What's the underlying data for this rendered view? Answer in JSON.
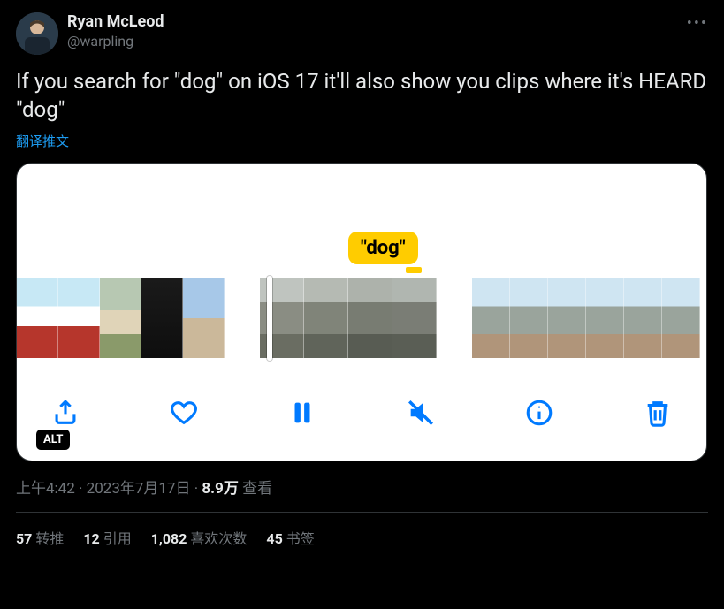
{
  "user": {
    "display_name": "Ryan McLeod",
    "handle": "@warpling"
  },
  "tweet_text": "If you search for \"dog\" on iOS 17 it'll also show you clips where it's HEARD \"dog\"",
  "translate_label": "翻译推文",
  "media": {
    "dog_tag": "\"dog\"",
    "alt_badge": "ALT",
    "icons": {
      "share": "share-icon",
      "like": "heart-icon",
      "pause": "pause-icon",
      "mute": "speaker-muted-icon",
      "info": "info-icon",
      "trash": "trash-icon"
    }
  },
  "timestamp": {
    "time": "上午4:42",
    "sep1": " · ",
    "date": "2023年7月17日",
    "sep2": " · ",
    "views_count": "8.9万",
    "views_label": " 查看"
  },
  "stats": {
    "retweets_count": "57",
    "retweets_label": "转推",
    "quotes_count": "12",
    "quotes_label": "引用",
    "likes_count": "1,082",
    "likes_label": "喜欢次数",
    "bookmarks_count": "45",
    "bookmarks_label": "书签"
  },
  "more_label": "•••"
}
